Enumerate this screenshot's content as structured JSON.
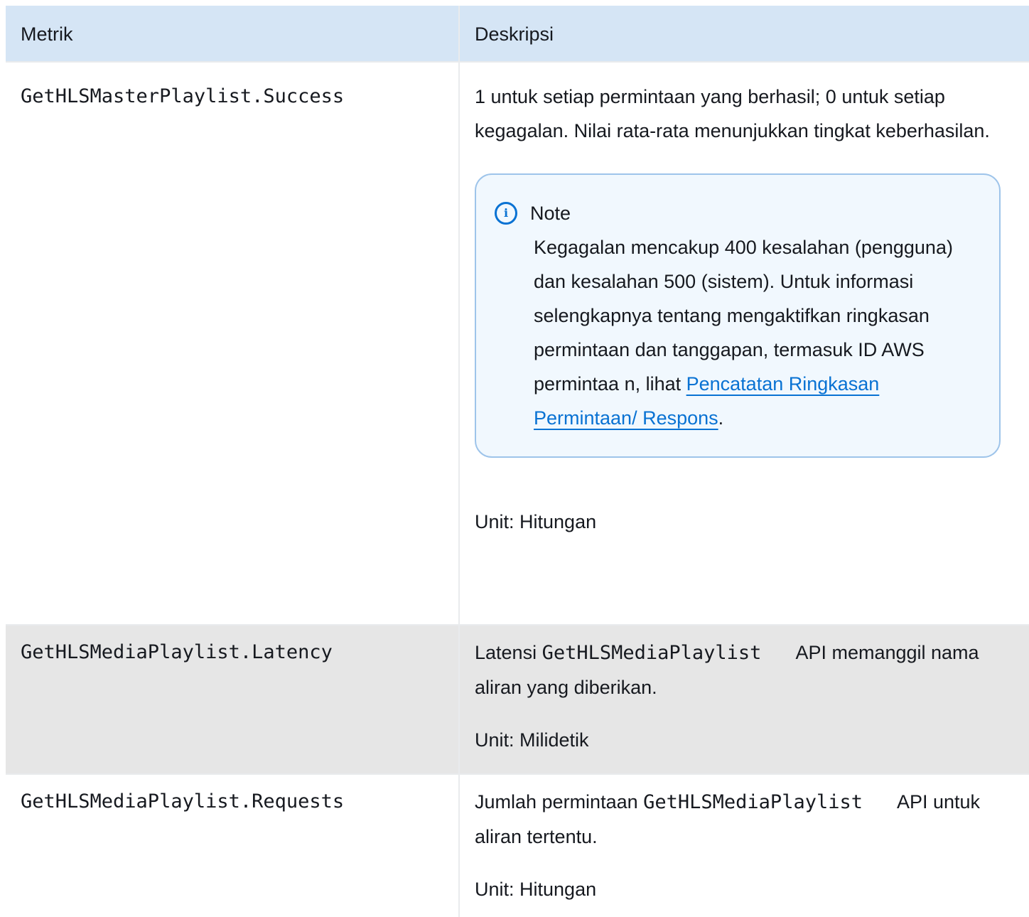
{
  "header": {
    "col1": "Metrik",
    "col2": "Deskripsi"
  },
  "rows": [
    {
      "name": "GetHLSMasterPlaylist.Success",
      "description": "1 untuk setiap permintaan yang berhasil; 0 untuk setiap kegagalan. Nilai rata-rata menunjukkan tingkat keberhasilan.",
      "note": {
        "title": "Note",
        "text_before": "Kegagalan mencakup 400 kesalahan (pengguna) dan kesalahan 500 (sistem). Untuk informasi selengkapnya tentang mengaktifkan ringkasan permintaan dan tanggapan, termasuk ID AWS permintaa n, lihat ",
        "link": "Pencatatan Ringkasan Permintaan/ Respons",
        "text_after": "."
      },
      "unit": "Unit: Hitungan"
    },
    {
      "name": "GetHLSMediaPlaylist.Latency",
      "desc_prefix": "Latensi ",
      "desc_code": "GetHLSMediaPlaylist",
      "desc_suffix": "API memanggil nama aliran yang diberikan.",
      "unit": "Unit: Milidetik"
    },
    {
      "name": "GetHLSMediaPlaylist.Requests",
      "desc_prefix": "Jumlah permintaan ",
      "desc_code": "GetHLSMediaPlaylist",
      "desc_suffix": "API untuk aliran tertentu.",
      "unit": "Unit: Hitungan"
    }
  ],
  "icons": {
    "info": "info-circle-icon",
    "info_color": "#0972d3"
  }
}
